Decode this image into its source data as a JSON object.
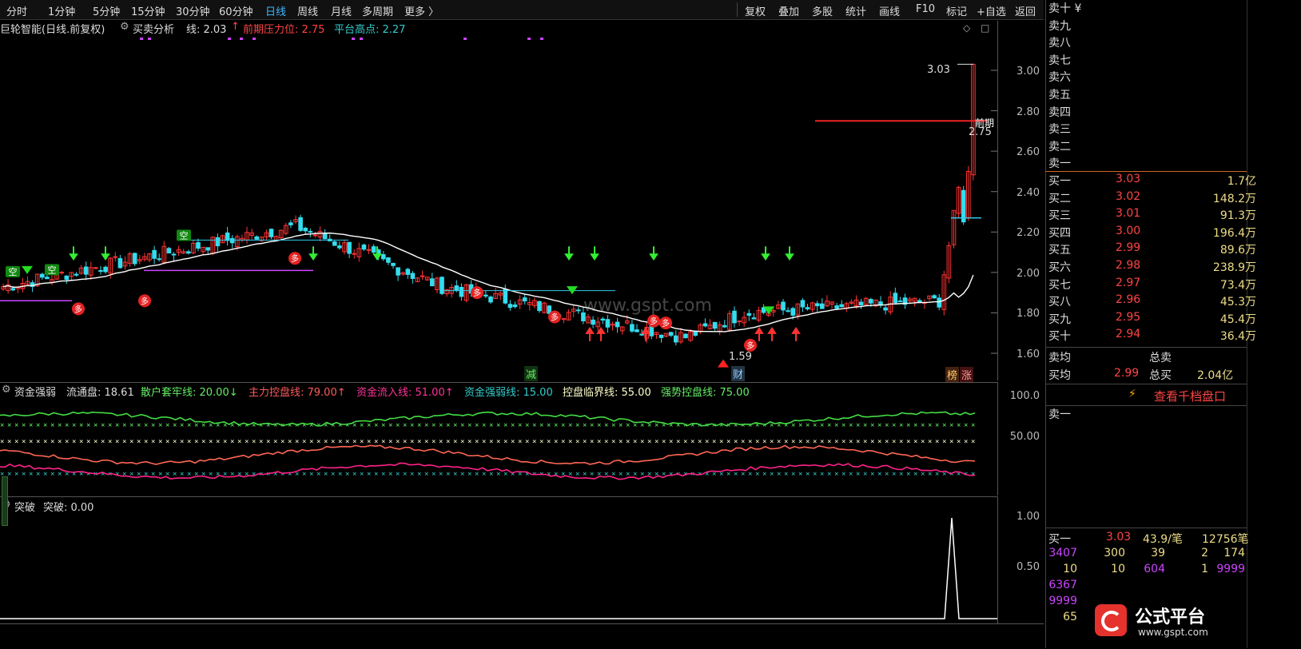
{
  "toolbar": {
    "periods": [
      "分时",
      "1分钟",
      "5分钟",
      "15分钟",
      "30分钟",
      "60分钟",
      "日线",
      "周线",
      "月线",
      "多周期",
      "更多 〉"
    ],
    "active_period": "日线",
    "actions": [
      "复权",
      "叠加",
      "多股",
      "统计",
      "画线",
      "F10",
      "标记",
      "+自选",
      "返回"
    ]
  },
  "price_panel": {
    "stock": "巨轮智能(日线.前复权)",
    "indicator_name": "买卖分析",
    "line_label": "线: 2.03",
    "arrow_up": "↑",
    "pressure_label": "前期压力位: 2.75",
    "platform_label": "平台高点: 2.27",
    "axis_ticks": [
      "3.00",
      "2.80",
      "2.60",
      "2.40",
      "2.20",
      "2.00",
      "1.80",
      "1.60"
    ],
    "high_label": "3.03",
    "low_label": "1.59",
    "pressure_tag": "前期",
    "pressure_value": "2.75",
    "marker_kong": "空",
    "marker_duo": "多",
    "marker_jian": "减",
    "marker_cai": "财",
    "marker_bang": "榜",
    "marker_zhang": "涨",
    "watermark_text": "www.gspt.com"
  },
  "indicator1": {
    "name": "资金强弱",
    "items": [
      {
        "text": "流通盘: 18.61",
        "color": "#dddddd"
      },
      {
        "text": "散户套牢线: 20.00↓",
        "color": "#66ee66"
      },
      {
        "text": "主力控盘线: 79.00↑",
        "color": "#ff5a5a"
      },
      {
        "text": "资金流入线: 51.00↑",
        "color": "#ff3399"
      },
      {
        "text": "资金强弱线: 15.00",
        "color": "#33cccc"
      },
      {
        "text": "控盘临界线: 55.00",
        "color": "#ffffcc"
      },
      {
        "text": "强势控盘线: 75.00",
        "color": "#66ee66"
      }
    ],
    "axis_ticks": [
      "100.0",
      "50.00"
    ]
  },
  "indicator2": {
    "name": "突破",
    "value_label": "突破: 0.00",
    "axis_ticks": [
      "1.00",
      "0.50"
    ]
  },
  "orderbook": {
    "sell_labels": [
      "卖十 ¥",
      "卖九",
      "卖八",
      "卖七",
      "卖六",
      "卖五",
      "卖四",
      "卖三",
      "卖二",
      "卖一"
    ],
    "buy_rows": [
      {
        "label": "买一",
        "price": "3.03",
        "vol": "1.7亿"
      },
      {
        "label": "买二",
        "price": "3.02",
        "vol": "148.2万"
      },
      {
        "label": "买三",
        "price": "3.01",
        "vol": "91.3万"
      },
      {
        "label": "买四",
        "price": "3.00",
        "vol": "196.4万"
      },
      {
        "label": "买五",
        "price": "2.99",
        "vol": "89.6万"
      },
      {
        "label": "买六",
        "price": "2.98",
        "vol": "238.9万"
      },
      {
        "label": "买七",
        "price": "2.97",
        "vol": "73.4万"
      },
      {
        "label": "买八",
        "price": "2.96",
        "vol": "45.3万"
      },
      {
        "label": "买九",
        "price": "2.95",
        "vol": "45.4万"
      },
      {
        "label": "买十",
        "price": "2.94",
        "vol": "36.4万"
      }
    ],
    "avg_sell_label": "卖均",
    "total_sell_label": "总卖",
    "avg_buy_label": "买均",
    "avg_buy_price": "2.99",
    "total_buy_label": "总买",
    "total_buy_vol": "2.04亿",
    "thousand_link": "查看千档盘口",
    "sell1_label": "卖一",
    "bottom_buy": {
      "label": "买一",
      "price": "3.03",
      "per": "43.9/笔",
      "count": "12756笔"
    },
    "queue_rows": [
      [
        "3407",
        "300",
        "39",
        "2",
        "174"
      ],
      [
        "10",
        "10",
        "604",
        "1",
        "9999"
      ],
      [
        "6367",
        "",
        "",
        "",
        ""
      ],
      [
        "9999",
        "",
        "",
        "",
        ""
      ],
      [
        "65",
        "",
        "",
        "",
        ""
      ]
    ],
    "logo_text": "公式平台",
    "logo_url": "www.gspt.com"
  }
}
